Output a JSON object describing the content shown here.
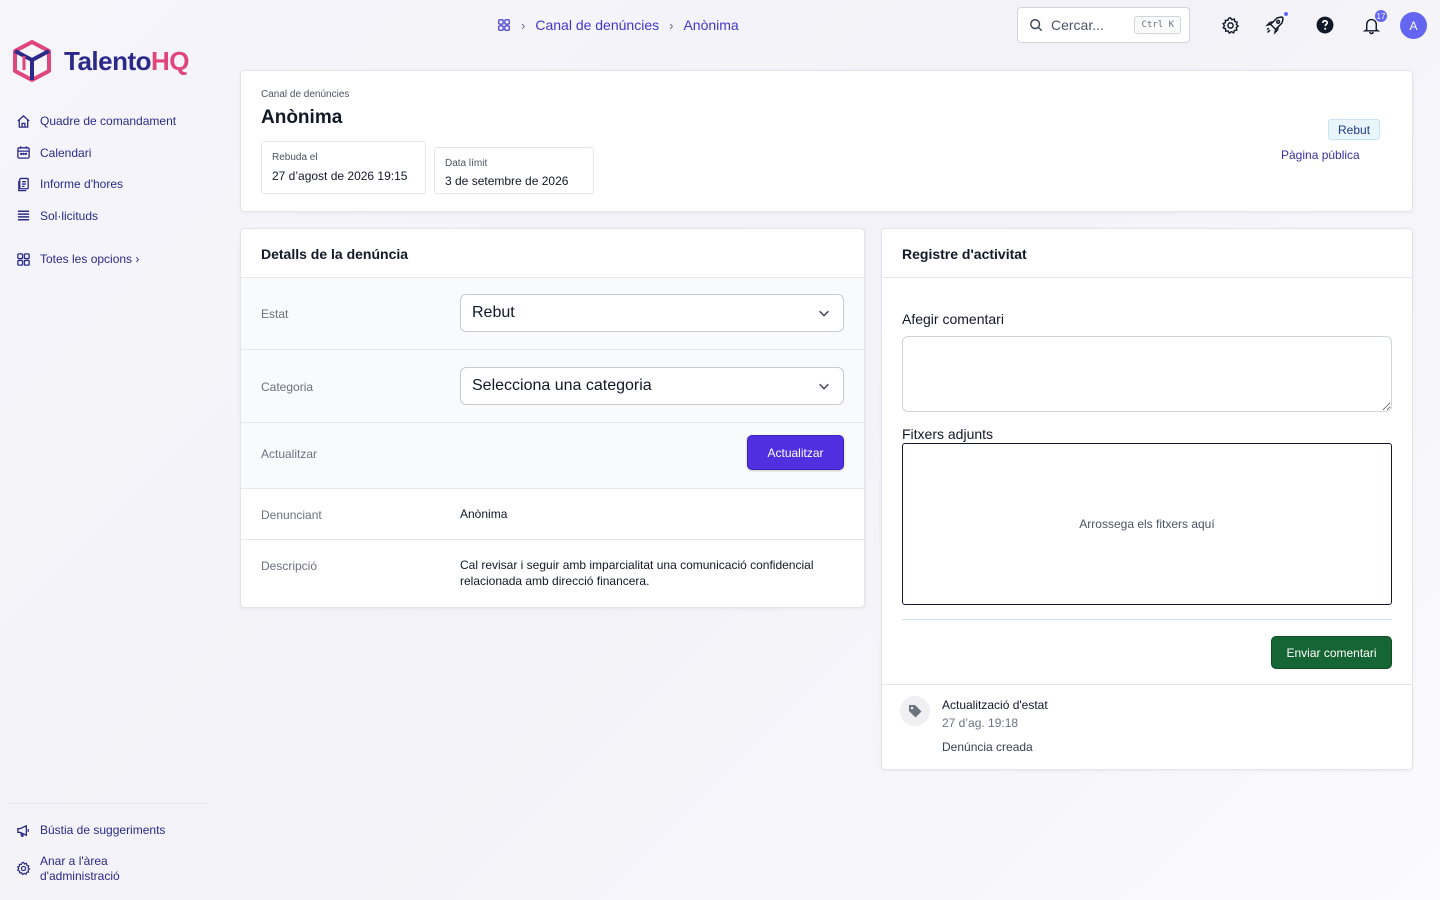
{
  "brand": {
    "name_main": "Talento",
    "name_accent": "HQ",
    "color_primary": "#2b2a8a",
    "color_accent": "#e0457b"
  },
  "sidebar": {
    "items": [
      {
        "label": "Quadre de comandament",
        "icon": "home-icon"
      },
      {
        "label": "Calendari",
        "icon": "calendar-icon"
      },
      {
        "label": "Informe d'hores",
        "icon": "document-icon"
      },
      {
        "label": "Sol·licituds",
        "icon": "list-icon"
      }
    ],
    "all_options": "Totes les opcions ›",
    "bottom": [
      {
        "label": "Bústia de suggeriments",
        "icon": "megaphone-icon"
      },
      {
        "label": "Anar a l'àrea d'administració",
        "icon": "gear-icon"
      }
    ]
  },
  "topbar": {
    "breadcrumb": [
      "Canal de denúncies",
      "Anònima"
    ],
    "search_placeholder": "Cercar...",
    "search_shortcut": "Ctrl K",
    "notification_count": "17",
    "avatar_initial": "A"
  },
  "header": {
    "subtitle": "Canal de denúncies",
    "title": "Anònima",
    "received_label": "Rebuda el",
    "received_value": "27 d’agost de 2026 19:15",
    "deadline_label": "Data límit",
    "deadline_value": "3 de setembre de 2026",
    "status": "Rebut",
    "public_link": "Pàgina pública"
  },
  "details": {
    "title": "Detalls de la denúncia",
    "state_label": "Estat",
    "state_value": "Rebut",
    "category_label": "Categoria",
    "category_placeholder": "Selecciona una categoria",
    "update_label": "Actualitzar",
    "update_button": "Actualitzar",
    "reporter_label": "Denunciant",
    "reporter_value": "Anònima",
    "description_label": "Descripció",
    "description_value": "Cal revisar i seguir amb imparcialitat una comunicació confidencial relacionada amb direcció financera."
  },
  "activity": {
    "title": "Registre d'activitat",
    "comment_label": "Afegir comentari",
    "attachments_label": "Fitxers adjunts",
    "dropzone_text": "Arrossega els fitxers aquí",
    "send_button": "Enviar comentari",
    "events": [
      {
        "title": "Actualització d'estat",
        "time": "27 d’ag. 19:18",
        "description": "Denúncia creada"
      }
    ]
  }
}
